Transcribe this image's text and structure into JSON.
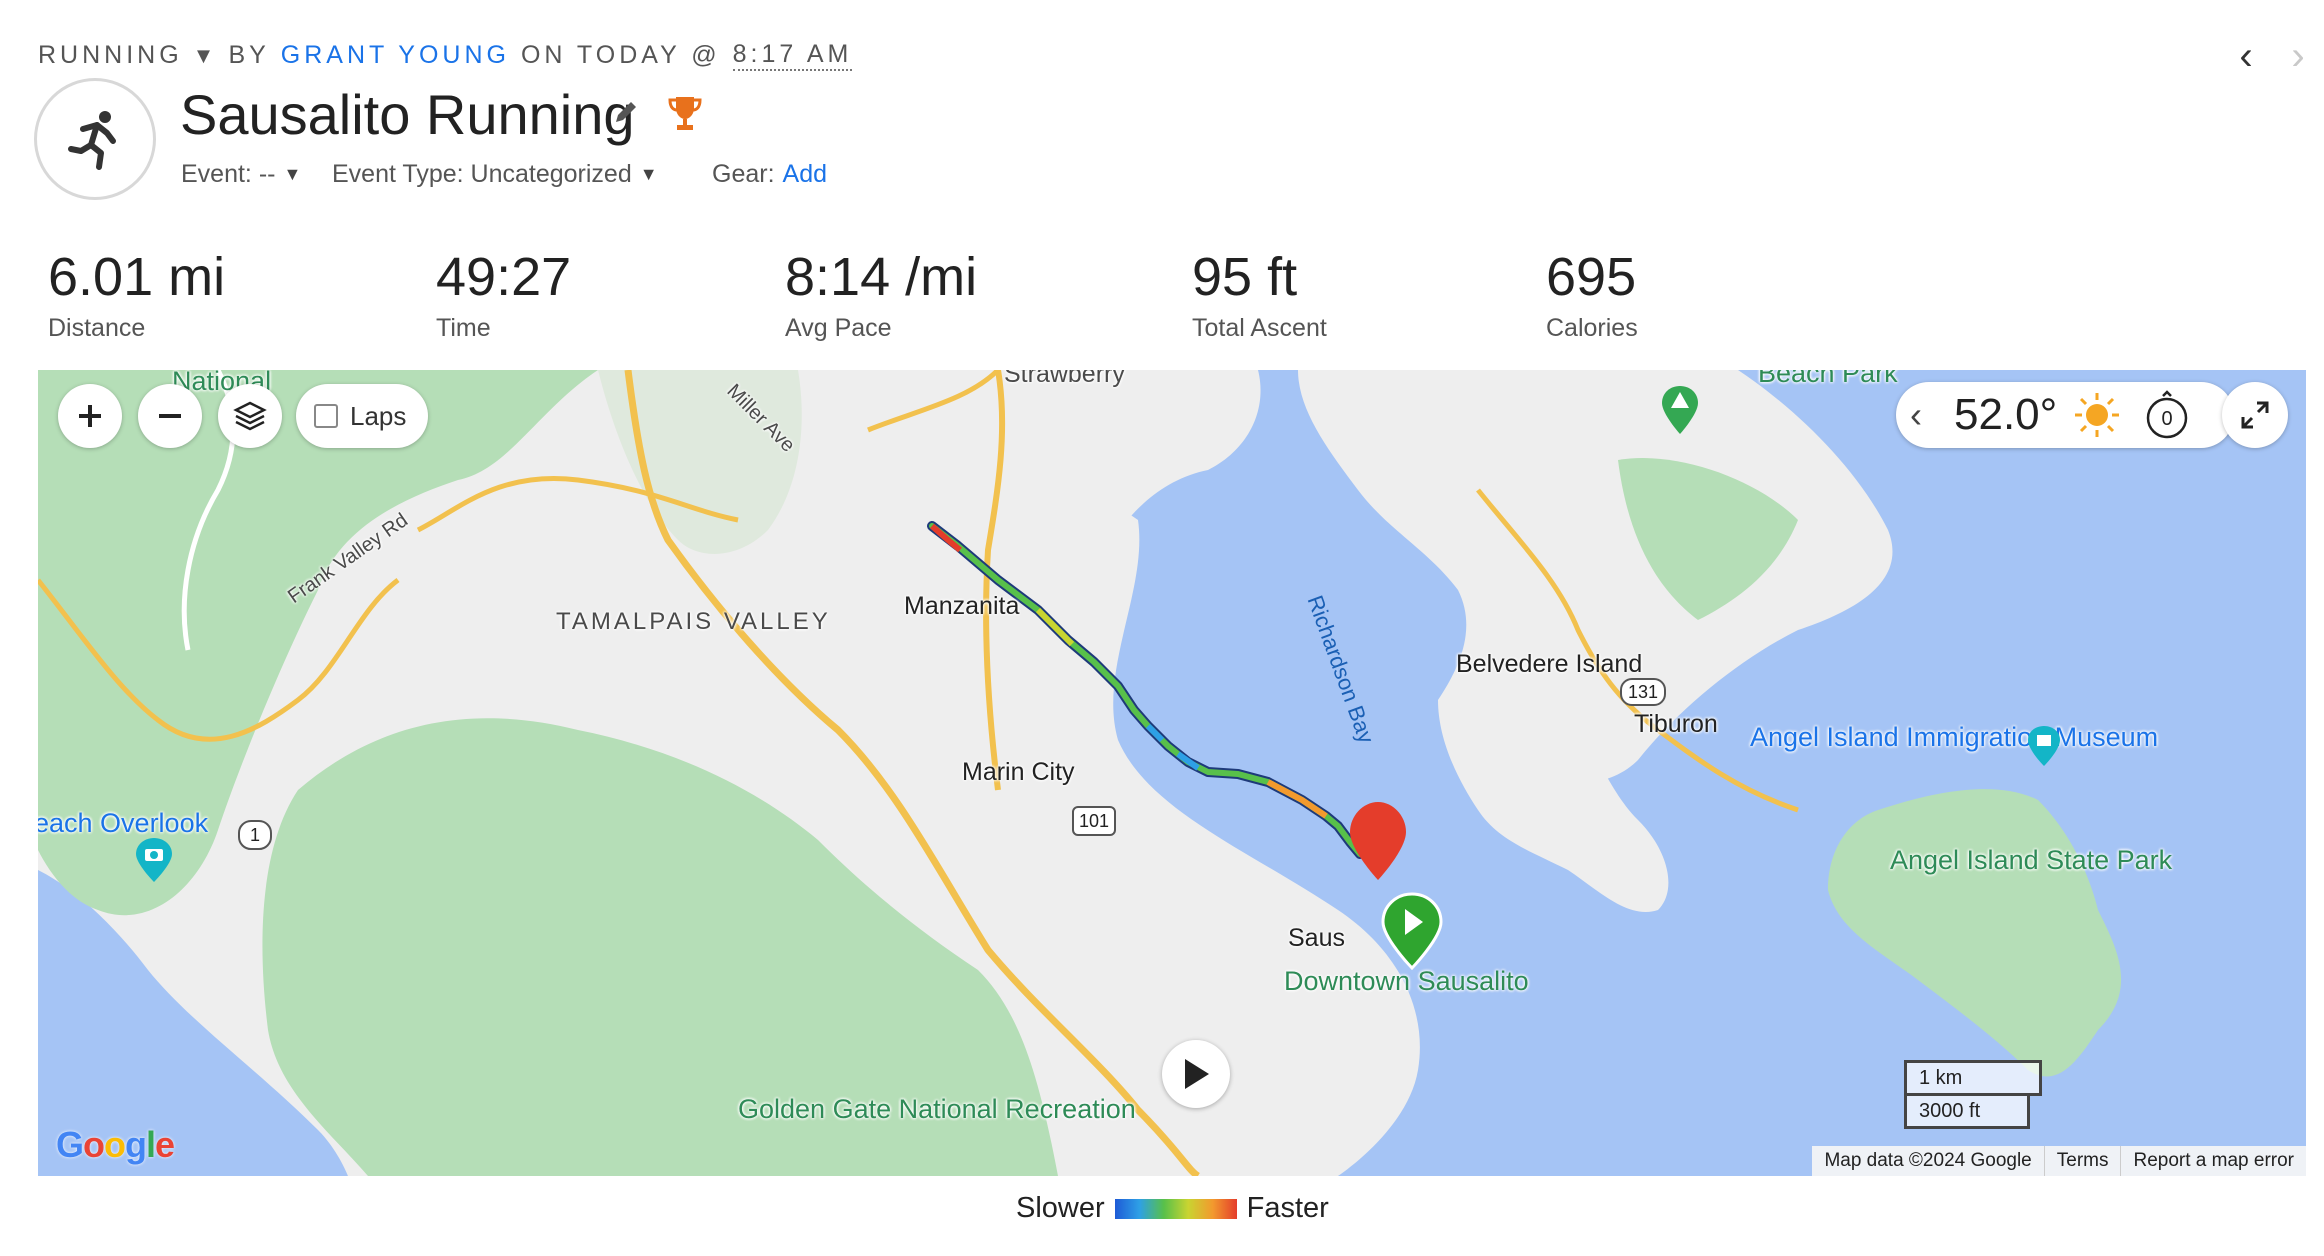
{
  "header": {
    "activity_type": "RUNNING",
    "by_label": "BY",
    "author": "GRANT YOUNG",
    "on_label": "ON TODAY @",
    "time": "8:17 AM",
    "title": "Sausalito Running",
    "event_label": "Event: --",
    "event_type_label": "Event Type: Uncategorized",
    "gear_label": "Gear:",
    "gear_add": "Add"
  },
  "stats": [
    {
      "value": "6.01 mi",
      "label": "Distance"
    },
    {
      "value": "49:27",
      "label": "Time"
    },
    {
      "value": "8:14 /mi",
      "label": "Avg Pace"
    },
    {
      "value": "95 ft",
      "label": "Total Ascent"
    },
    {
      "value": "695",
      "label": "Calories"
    }
  ],
  "map": {
    "controls": {
      "laps_label": "Laps"
    },
    "weather": {
      "temperature": "52.0°",
      "icon": "sun-icon"
    },
    "labels": {
      "strawberry": "Strawberry",
      "beach_park": "Beach Park",
      "miller_ave": "Miller Ave",
      "frank_valley_rd": "Frank Valley Rd",
      "national": "National",
      "tamalpais_valley": "TAMALPAIS VALLEY",
      "manzanita": "Manzanita",
      "richardson_bay": "Richardson Bay",
      "belvedere_island": "Belvedere Island",
      "tiburon": "Tiburon",
      "angel_island_museum": "Angel Island Immigration Museum",
      "marin_city": "Marin City",
      "beach_overlook": "each Overlook",
      "angel_island_park": "Angel Island State Park",
      "sausalito": "Saus",
      "downtown_sausalito": "Downtown Sausalito",
      "golden_gate": "Golden Gate National Recreation",
      "route_101": "101",
      "route_1": "1",
      "route_131": "131"
    },
    "scale": {
      "metric": "1 km",
      "imperial": "3000 ft"
    },
    "attribution": {
      "data": "Map data ©2024 Google",
      "terms": "Terms",
      "report": "Report a map error"
    },
    "logo": "Google"
  },
  "legend": {
    "slower": "Slower",
    "faster": "Faster"
  },
  "colors": {
    "accent": "#1a73e8",
    "land": "#eeeeee",
    "park": "#b5deb7",
    "water": "#a5c4f5",
    "road": "#f2c14e"
  }
}
